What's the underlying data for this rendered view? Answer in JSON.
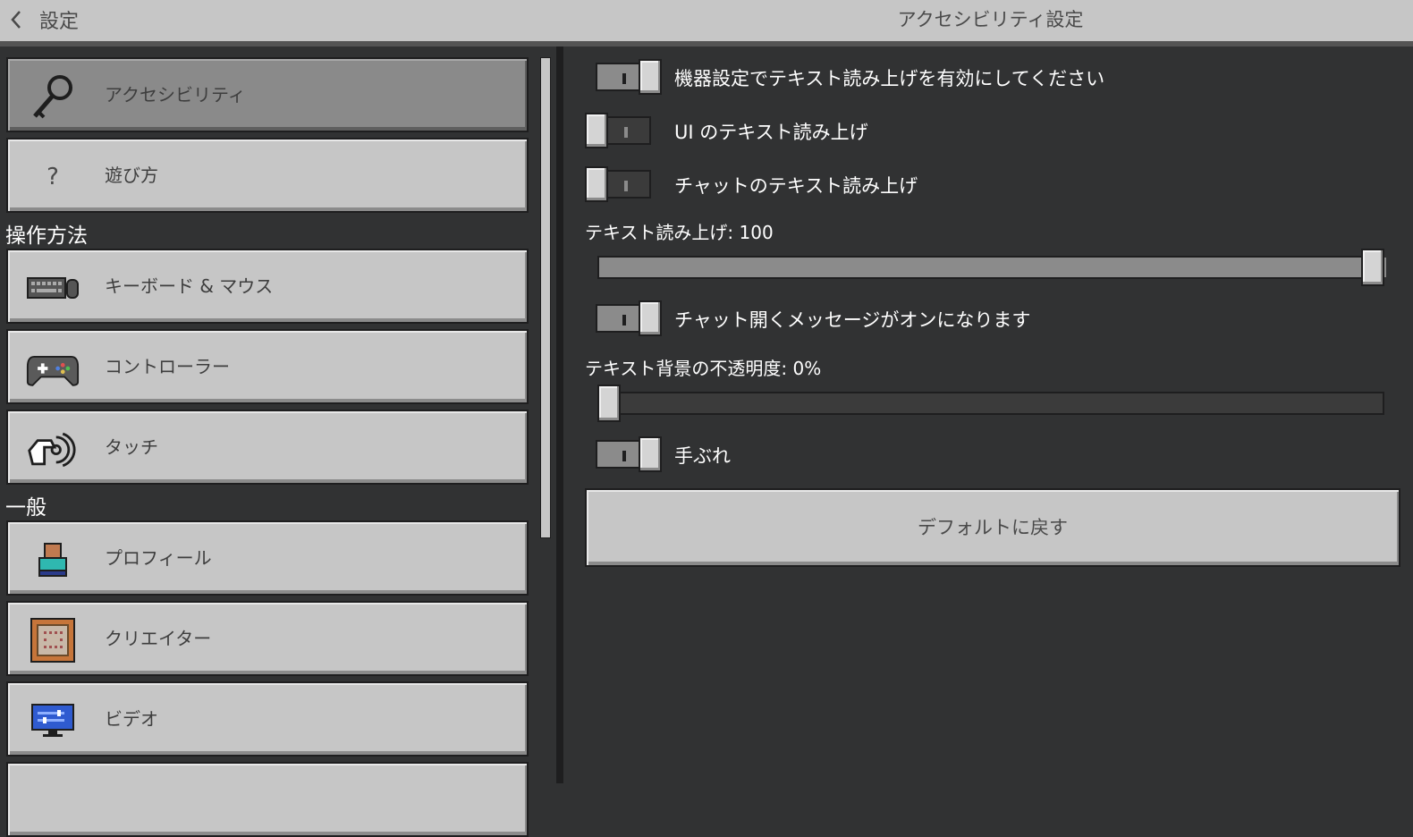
{
  "header": {
    "back_label": "設定",
    "title": "アクセシビリティ設定"
  },
  "sidebar": {
    "items_top": [
      {
        "label": "アクセシビリティ",
        "icon": "key-icon",
        "selected": true
      },
      {
        "label": "遊び方",
        "icon": "question-icon",
        "selected": false
      }
    ],
    "section_controls": "操作方法",
    "items_controls": [
      {
        "label": "キーボード & マウス",
        "icon": "keyboard-mouse-icon"
      },
      {
        "label": "コントローラー",
        "icon": "controller-icon"
      },
      {
        "label": "タッチ",
        "icon": "touch-icon"
      }
    ],
    "section_general": "一般",
    "items_general": [
      {
        "label": "プロフィール",
        "icon": "profile-icon"
      },
      {
        "label": "クリエイター",
        "icon": "creator-icon"
      },
      {
        "label": "ビデオ",
        "icon": "video-icon"
      }
    ]
  },
  "settings": {
    "device_tts": {
      "label": "機器設定でテキスト読み上げを有効にしてください",
      "on": true
    },
    "ui_tts": {
      "label": "UI のテキスト読み上げ",
      "on": false
    },
    "chat_tts": {
      "label": "チャットのテキスト読み上げ",
      "on": false
    },
    "tts_volume": {
      "label": "テキスト読み上げ: 100",
      "value": 100,
      "max": 100
    },
    "open_chat_message": {
      "label": "チャット開くメッセージがオンになります",
      "on": true
    },
    "text_bg_opacity": {
      "label": "テキスト背景の不透明度: 0%",
      "value": 0,
      "max": 100
    },
    "camera_shake": {
      "label": "手ぶれ",
      "on": true
    },
    "reset_label": "デフォルトに戻す"
  }
}
